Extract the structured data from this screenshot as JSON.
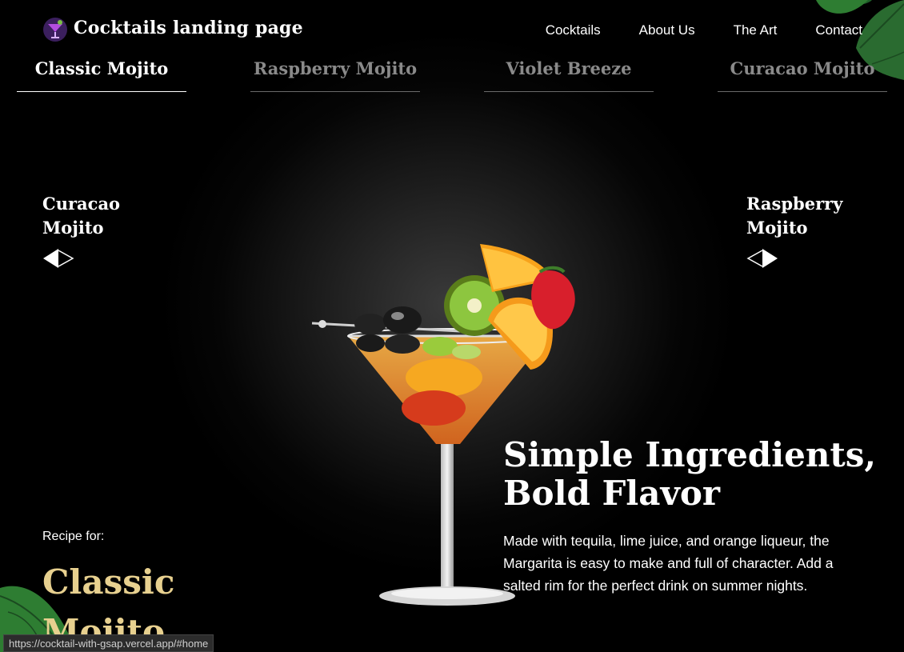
{
  "header": {
    "logo_text": "Cocktails landing page",
    "nav": [
      "Cocktails",
      "About Us",
      "The Art",
      "Contact"
    ]
  },
  "tabs": [
    {
      "label": "Classic Mojito",
      "active": true
    },
    {
      "label": "Raspberry Mojito",
      "active": false
    },
    {
      "label": "Violet Breeze",
      "active": false
    },
    {
      "label": "Curacao Mojito",
      "active": false
    }
  ],
  "side_nav": {
    "prev": {
      "label": "Curacao\nMojito",
      "icon": "arrow-left-icon"
    },
    "next": {
      "label": "Raspberry\nMojito",
      "icon": "arrow-right-icon"
    }
  },
  "hero": {
    "headline_line1": "Simple Ingredients,",
    "headline_line2": "Bold Flavor",
    "body": "Made with tequila, lime juice, and orange liqueur, the Margarita is easy to make and full of character. Add a salted rim for the perfect drink on summer nights."
  },
  "recipe": {
    "label": "Recipe for:",
    "name": "Classic\nMojito"
  },
  "status_bar": {
    "url": "https://cocktail-with-gsap.vercel.app/#home"
  },
  "colors": {
    "background": "#000000",
    "accent_gold": "#e7d08f",
    "inactive_tab": "#8a8a8a"
  }
}
